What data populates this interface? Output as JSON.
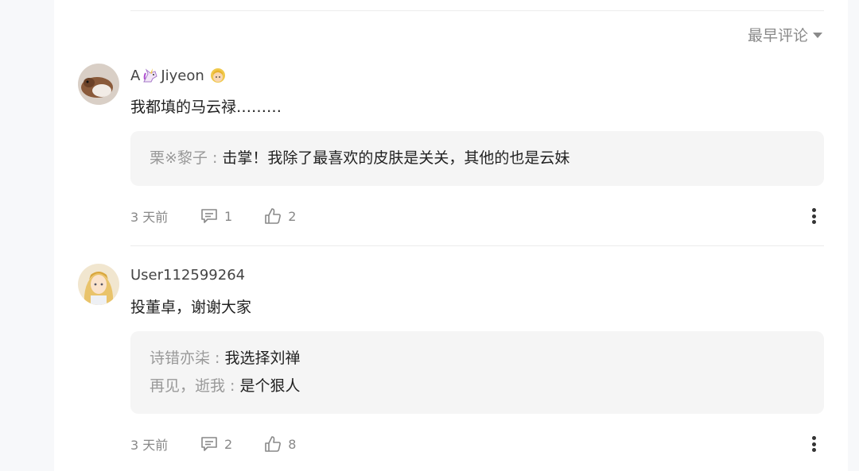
{
  "sort": {
    "label": "最早评论"
  },
  "comments": [
    {
      "user": {
        "prefix": "A",
        "name": "Jiyeon"
      },
      "text": "我都填的马云禄………",
      "replies": [
        {
          "name": "栗※黎子",
          "sep": " : ",
          "text": "击掌！我除了最喜欢的皮肤是关关，其他的也是云妹"
        }
      ],
      "time": "3 天前",
      "reply_count": "1",
      "like_count": "2"
    },
    {
      "user": {
        "name": "User112599264"
      },
      "text": "投董卓，谢谢大家",
      "replies": [
        {
          "name": "诗错亦柒",
          "sep": " : ",
          "text": "我选择刘禅"
        },
        {
          "name": "再见，逝我",
          "sep": " : ",
          "text": "是个狠人"
        }
      ],
      "time": "3 天前",
      "reply_count": "2",
      "like_count": "8"
    }
  ]
}
